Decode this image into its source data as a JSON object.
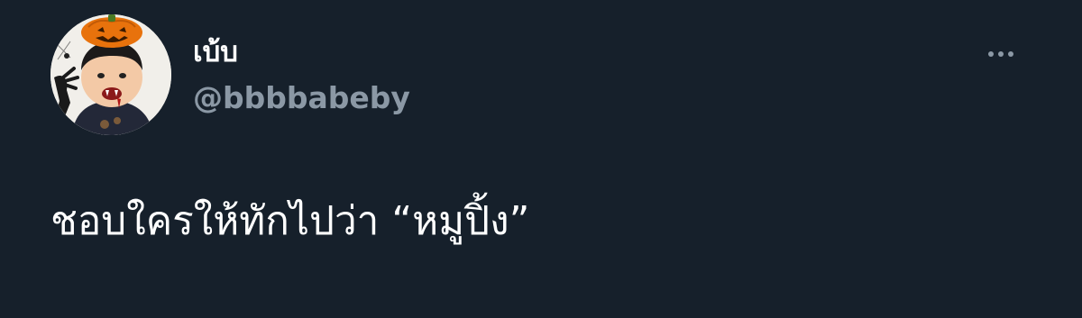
{
  "tweet": {
    "display_name": "เบ้บ",
    "handle": "@bbbbabeby",
    "text": "ชอบใครให้ทักไปว่า “หมูปิ้ง”",
    "more_icon": "more-horizontal-icon"
  },
  "avatar": {
    "description_icon": "profile-avatar"
  },
  "colors": {
    "background": "#16202b",
    "primary_text": "#ffffff",
    "secondary_text": "#8b98a5"
  }
}
